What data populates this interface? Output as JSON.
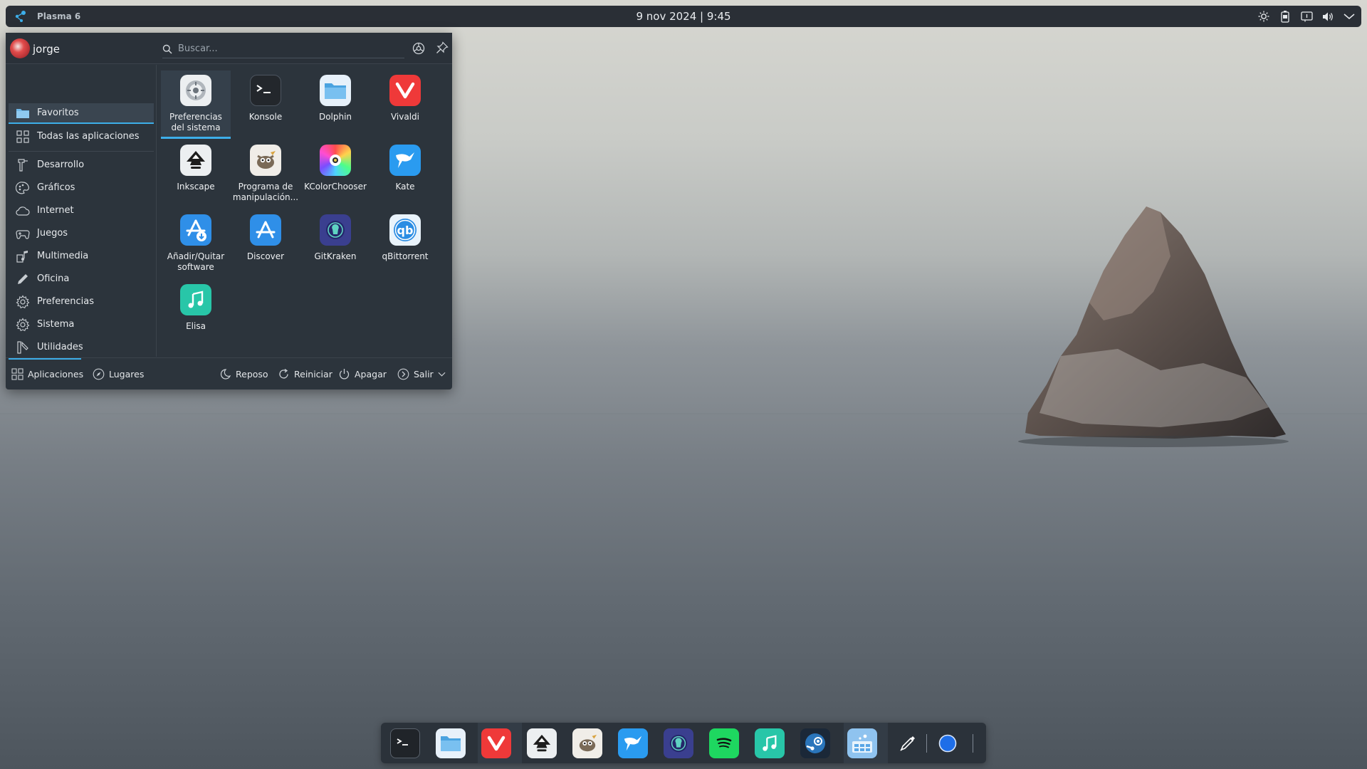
{
  "panel": {
    "title": "Plasma 6",
    "clock": "9 nov 2024 | 9:45",
    "tray": [
      "brightness-icon",
      "battery-icon",
      "notifications-icon",
      "volume-icon",
      "chevron-down-icon"
    ]
  },
  "launcher": {
    "user": "jorge",
    "search_placeholder": "Buscar...",
    "categories": [
      {
        "label": "Favoritos",
        "icon": "folder-icon"
      },
      {
        "label": "Todas las aplicaciones",
        "icon": "grid-icon"
      },
      {
        "label": "Desarrollo",
        "icon": "wrench-icon"
      },
      {
        "label": "Gráficos",
        "icon": "palette-icon"
      },
      {
        "label": "Internet",
        "icon": "cloud-icon"
      },
      {
        "label": "Juegos",
        "icon": "gamepad-icon"
      },
      {
        "label": "Multimedia",
        "icon": "multimedia-icon"
      },
      {
        "label": "Oficina",
        "icon": "pencil-icon"
      },
      {
        "label": "Preferencias",
        "icon": "gear-icon"
      },
      {
        "label": "Sistema",
        "icon": "gear-icon"
      },
      {
        "label": "Utilidades",
        "icon": "tools-icon"
      }
    ],
    "apps": [
      {
        "label": "Preferencias del sistema",
        "icon": "settings-app-icon"
      },
      {
        "label": "Konsole",
        "icon": "terminal-app-icon"
      },
      {
        "label": "Dolphin",
        "icon": "folder-app-icon"
      },
      {
        "label": "Vivaldi",
        "icon": "vivaldi-app-icon"
      },
      {
        "label": "Inkscape",
        "icon": "inkscape-app-icon"
      },
      {
        "label": "Programa de manipulación...",
        "icon": "gimp-app-icon"
      },
      {
        "label": "KColorChooser",
        "icon": "color-chooser-app-icon"
      },
      {
        "label": "Kate",
        "icon": "kate-app-icon"
      },
      {
        "label": "Añadir/Quitar software",
        "icon": "add-remove-software-app-icon"
      },
      {
        "label": "Discover",
        "icon": "discover-app-icon"
      },
      {
        "label": "GitKraken",
        "icon": "gitkraken-app-icon"
      },
      {
        "label": "qBittorrent",
        "icon": "qbittorrent-app-icon"
      },
      {
        "label": "Elisa",
        "icon": "elisa-app-icon"
      }
    ],
    "footer": {
      "tab_apps": "Aplicaciones",
      "tab_places": "Lugares",
      "sleep": "Reposo",
      "restart": "Reiniciar",
      "shutdown": "Apagar",
      "logout": "Salir"
    }
  },
  "dock": {
    "items": [
      "terminal-icon",
      "folder-icon",
      "vivaldi-icon",
      "inkscape-icon",
      "gimp-icon",
      "kate-icon",
      "gitkraken-icon",
      "spotify-icon",
      "music-icon",
      "steam-icon",
      "app-launcher-icon",
      "color-picker-icon",
      "blue-circle-icon"
    ]
  },
  "colors": {
    "accent": "#3daee9",
    "panel_bg": "#2a2f36",
    "launcher_bg": "#2c343c"
  }
}
